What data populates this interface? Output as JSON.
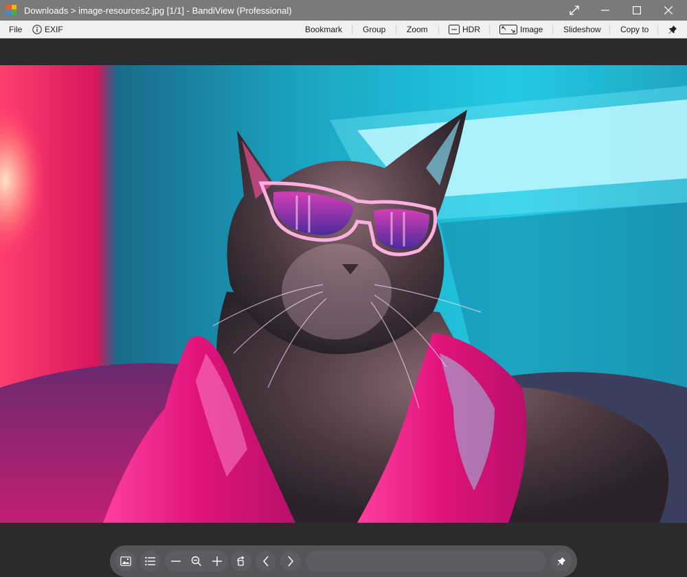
{
  "window": {
    "title": "Downloads > image-resources2.jpg [1/1] - BandiView (Professional)"
  },
  "menubar": {
    "left": [
      {
        "label": "File"
      },
      {
        "label": "EXIF",
        "icon": "info-icon"
      }
    ],
    "right": [
      {
        "label": "Bookmark"
      },
      {
        "label": "Group"
      },
      {
        "label": "Zoom"
      },
      {
        "label": "HDR",
        "icon": "hdr-icon"
      },
      {
        "label": "Image",
        "icon": "image-fit-icon"
      },
      {
        "label": "Slideshow"
      },
      {
        "label": "Copy to"
      },
      {
        "label": "",
        "icon": "pin-icon"
      }
    ]
  },
  "toolbar": {
    "buttons": [
      "image-icon",
      "list-icon",
      "zoom-out-icon",
      "zoom-reset-icon",
      "zoom-in-icon",
      "rotate-icon",
      "previous-icon",
      "next-icon",
      "pin-icon"
    ],
    "slider_value": 0
  },
  "colors": {
    "titlebar": "#7a7a7a",
    "menubar": "#f0f0f0",
    "viewer_bg": "#2b2b2b",
    "neon_pink": "#ff2a8a",
    "neon_cyan": "#1fd0e8"
  }
}
